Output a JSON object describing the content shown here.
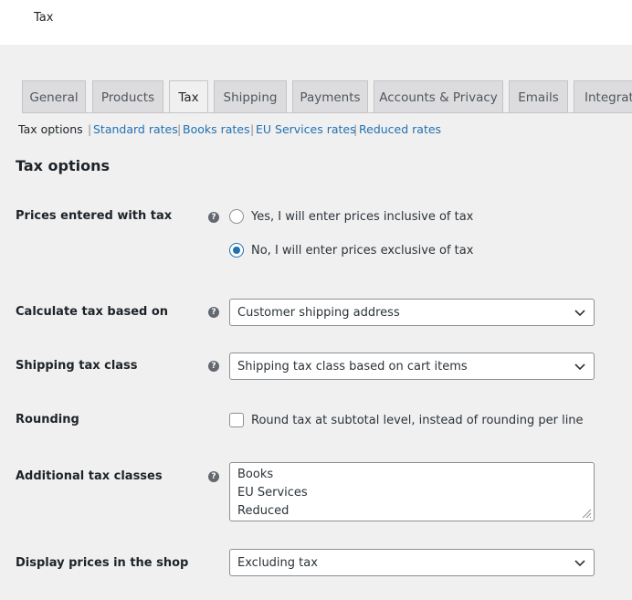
{
  "header": {
    "title": "Tax"
  },
  "tabs": [
    {
      "label": "General"
    },
    {
      "label": "Products"
    },
    {
      "label": "Tax"
    },
    {
      "label": "Shipping"
    },
    {
      "label": "Payments"
    },
    {
      "label": "Accounts & Privacy"
    },
    {
      "label": "Emails"
    },
    {
      "label": "Integration"
    }
  ],
  "subnav": {
    "current": "Tax options",
    "links": [
      "Standard rates",
      "Books rates",
      "EU Services rates",
      "Reduced rates"
    ],
    "separator": "|"
  },
  "section_title": "Tax options",
  "fields": {
    "prices_entered": {
      "label": "Prices entered with tax",
      "options": [
        "Yes, I will enter prices inclusive of tax",
        "No, I will enter prices exclusive of tax"
      ],
      "selected": "No, I will enter prices exclusive of tax"
    },
    "calculate_based_on": {
      "label": "Calculate tax based on",
      "value": "Customer shipping address"
    },
    "shipping_tax_class": {
      "label": "Shipping tax class",
      "value": "Shipping tax class based on cart items"
    },
    "rounding": {
      "label": "Rounding",
      "checkbox_label": "Round tax at subtotal level, instead of rounding per line",
      "checked": false
    },
    "additional_classes": {
      "label": "Additional tax classes",
      "lines": [
        "Books",
        "EU Services",
        "Reduced"
      ]
    },
    "display_prices": {
      "label": "Display prices in the shop",
      "value": "Excluding tax"
    }
  },
  "help_icon_glyph": "?",
  "colors": {
    "link": "#2271b1",
    "background": "#f0f0f1",
    "tab_inactive": "#dcdcde"
  }
}
